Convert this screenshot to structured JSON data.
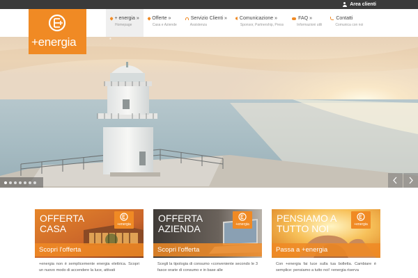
{
  "topbar": {
    "area_clienti": "Area clienti"
  },
  "logo": {
    "text": "+energia",
    "reg": "®"
  },
  "nav": [
    {
      "label": "+ energia »",
      "sub": "Homepage",
      "icon": "pin-icon"
    },
    {
      "label": "Offerte »",
      "sub": "Casa e Aziende",
      "icon": "pin-icon"
    },
    {
      "label": "Servizio Clienti »",
      "sub": "Assistenza",
      "icon": "headset-icon"
    },
    {
      "label": "Comunicazione »",
      "sub": "Sponsor, Partnership, Press",
      "icon": "megaphone-icon"
    },
    {
      "label": "FAQ »",
      "sub": "Informazioni utili",
      "icon": "chat-icon"
    },
    {
      "label": "Contatti",
      "sub": "Comunica con noi",
      "icon": "phone-icon"
    }
  ],
  "slider": {
    "dots": 7,
    "active_dot": 0
  },
  "cards": [
    {
      "title_line1": "OFFERTA",
      "title_line2": "CASA",
      "badge": "+energia",
      "cta": "Scopri l'offerta",
      "text": "+energia non è semplicemente energia elettrica. Scopri un nuovo modo di accendere la luce, attivati"
    },
    {
      "title_line1": "OFFERTA",
      "title_line2": "AZIENDA",
      "badge": "+energia",
      "cta": "Scopri l'offerta",
      "text": "Scegli la tipologia di consumo «conveniente secondo le 3 fasce orarie di consumo e in base alle"
    },
    {
      "title_line1": "PENSIAMO A",
      "title_line2": "TUTTO NOI",
      "badge": "+energia",
      "cta": "Passa a +energia",
      "text": "Con +energia fai luce sulla tua bolletta. Cambiare è semplice: pensiamo a tutto noi! +energia riserva"
    }
  ],
  "colors": {
    "brand": "#f08a24",
    "topbar": "#3a3a3a"
  }
}
